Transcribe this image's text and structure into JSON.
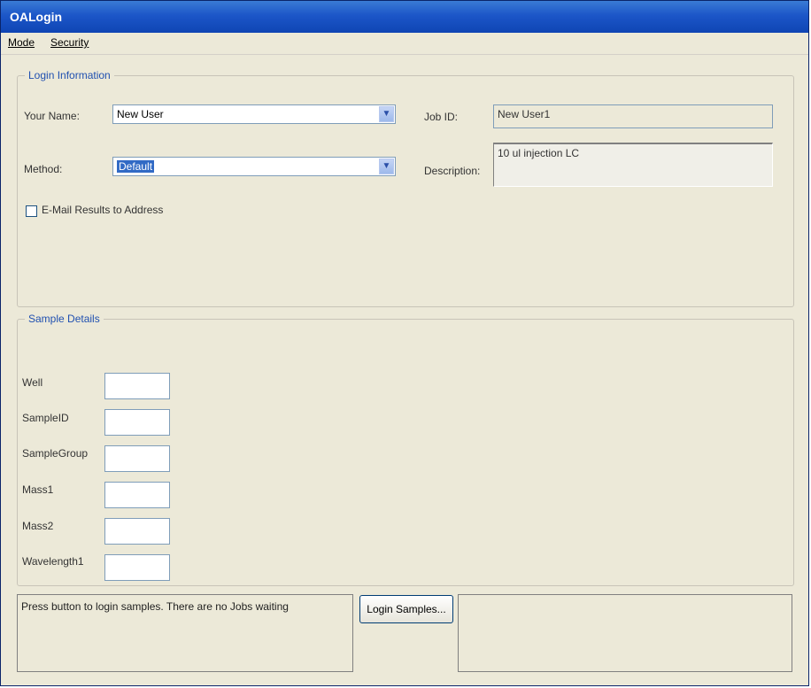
{
  "window": {
    "title": "OALogin"
  },
  "menu": [
    {
      "label": "Mode"
    },
    {
      "label": "Security"
    }
  ],
  "login_info": {
    "title": "Login Information",
    "your_name_label": "Your Name:",
    "your_name_value": "New User",
    "method_label": "Method:",
    "method_value": "Default",
    "job_id_label": "Job ID:",
    "job_id_value": "New User1",
    "description_label": "Description:",
    "description_value": "10 ul injection LC",
    "email_checkbox_label": "E-Mail Results to Address",
    "email_checked": false
  },
  "sample_details": {
    "title": "Sample Details",
    "fields": [
      {
        "label": "Well",
        "value": ""
      },
      {
        "label": "SampleID",
        "value": ""
      },
      {
        "label": "SampleGroup",
        "value": ""
      },
      {
        "label": "Mass1",
        "value": ""
      },
      {
        "label": "Mass2",
        "value": ""
      },
      {
        "label": "Wavelength1",
        "value": ""
      }
    ]
  },
  "footer": {
    "status_text": "Press button to login samples. There are no Jobs waiting",
    "login_button_label": "Login Samples..."
  },
  "colors": {
    "titlebar": "#1c56c8",
    "group_title": "#2050b0",
    "window_bg": "#ece9d8"
  }
}
